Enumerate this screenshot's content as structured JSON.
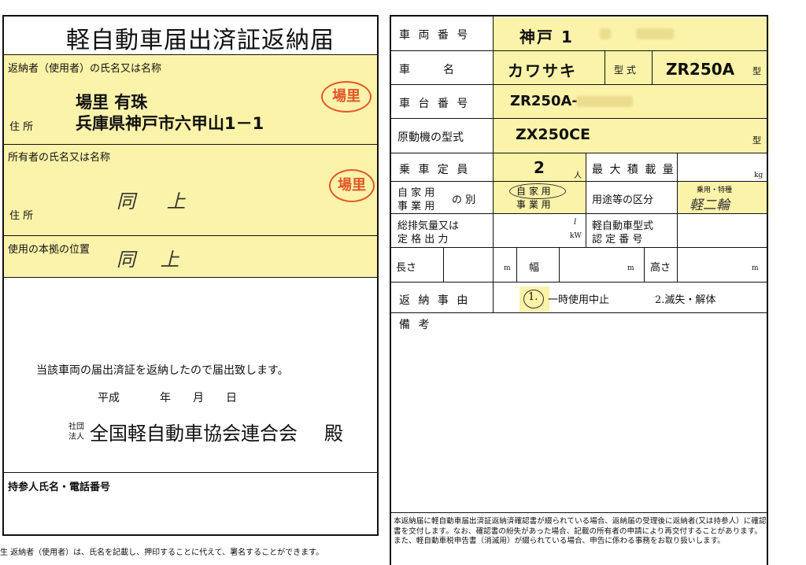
{
  "left": {
    "form_title": "軽自動車届出済証返納届",
    "returner_label": "返納者（使用者）の氏名又は名称",
    "returner_name": "場里 有珠",
    "returner_address_label": "住 所",
    "returner_address": "兵庫県神戸市六甲山1－1",
    "stamp_text": "場里",
    "owner_label": "所有者の氏名又は名称",
    "owner_value": "同 上",
    "owner_address_label": "住 所",
    "usage_location_label": "使用の本拠の位置",
    "usage_location_value": "同 上",
    "declaration": "当該車両の届出済証を返納したので届出致します。",
    "date_era": "平成",
    "date_year": "年",
    "date_month": "月",
    "date_day": "日",
    "assoc_prefix_top": "社団",
    "assoc_prefix_bottom": "法人",
    "addressee": "全国軽自動車協会連合会",
    "honorific": "殿",
    "bearer_label": "持参人氏名・電話番号",
    "footnote": "生 返納者（使用者）は、氏名を記載し、押印することに代えて、署名することができます。"
  },
  "right": {
    "plate_label": "車 両 番 号",
    "plate_value": "神戸 1",
    "car_name_label": "車　　　名",
    "car_name_value": "カワサキ",
    "model_label": "型 式",
    "model_value": "ZR250A",
    "model_suffix": "型",
    "chassis_label": "車 台 番 号",
    "chassis_value": "ZR250A-",
    "engine_label": "原動機の型式",
    "engine_value": "ZX250CE",
    "engine_suffix": "型",
    "capacity_label": "乗 車 定 員",
    "capacity_value": "2",
    "capacity_unit": "人",
    "max_load_label": "最 大 積 載 量",
    "max_load_unit": "kg",
    "private_label_1": "自 家 用",
    "private_label_2": "事 業 用",
    "private_label_suffix": "の 別",
    "private_opt_1": "自 家 用",
    "private_opt_2": "事 業 用",
    "use_class_label": "用途等の区分",
    "use_class_small": "乗用・特種",
    "use_class_value": "軽二輪",
    "displacement_label_1": "総排気量又は",
    "displacement_label_2": "定 格 出 力",
    "displacement_unit_1": "l",
    "displacement_unit_2": "kW",
    "cert_label_1": "軽自動車型式",
    "cert_label_2": "認 定 番 号",
    "length_label": "長さ",
    "width_label": "幅",
    "height_label": "高さ",
    "dim_unit": "m",
    "reason_label": "返 納 事 由",
    "reason_1": "1.",
    "reason_1_text": "一時使用中止",
    "reason_2": "2.滅失・解体",
    "remarks_label": "備 考",
    "notice": "本返納届に軽自動車届出済証返納済確認書が綴られている場合、返納届の受理後に返納者(又は持参人）に確認書を交付します。なお、確認書の紛失があった場合、記載の所有者の申請により再交付することがあります。また、軽自動車税申告書（消滅用）が綴られている場合、申告に係わる事務をお取り扱いします。"
  }
}
